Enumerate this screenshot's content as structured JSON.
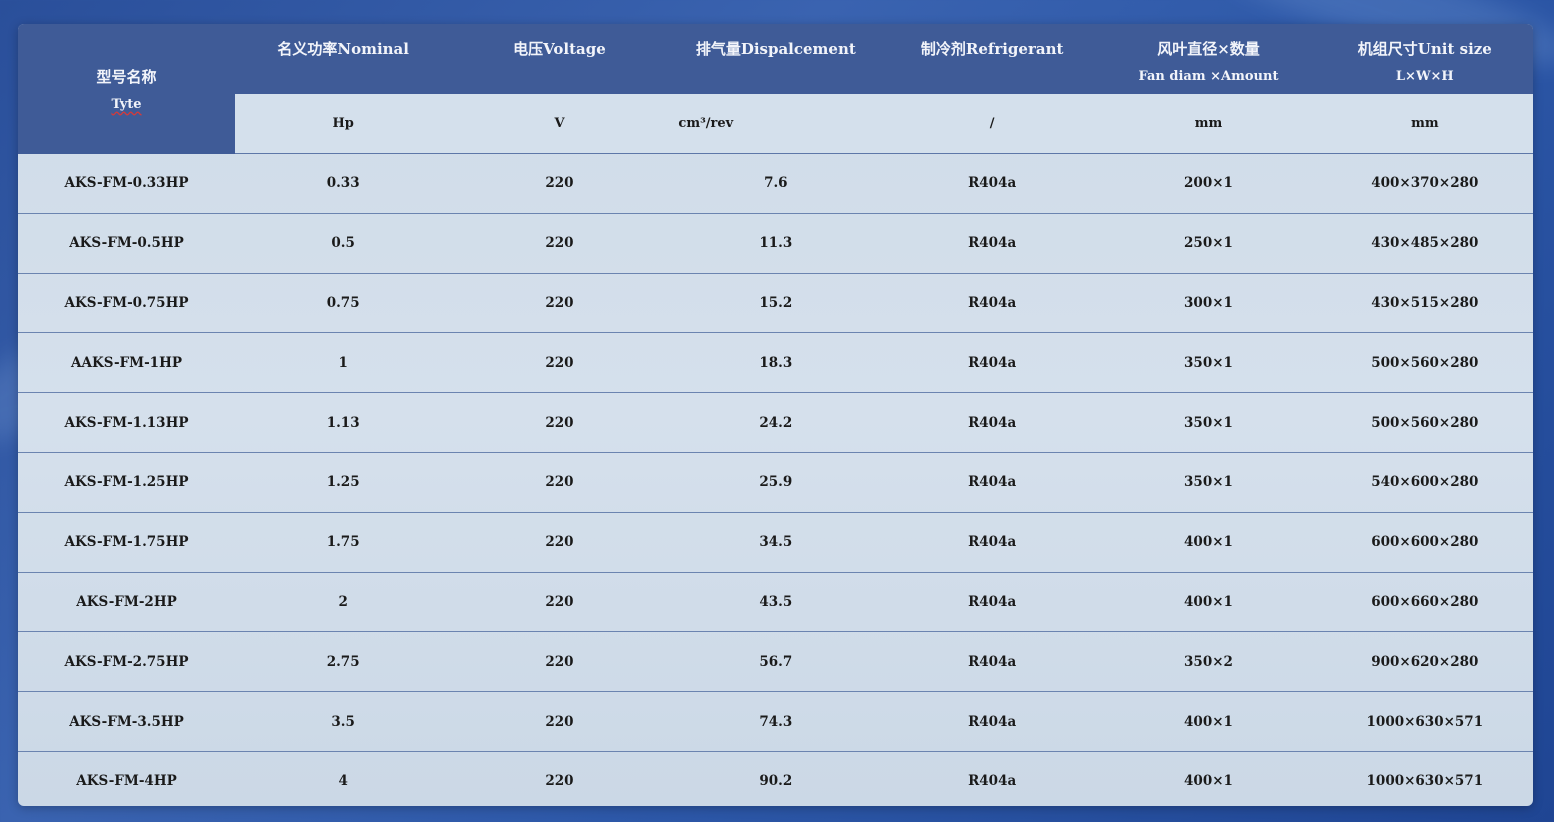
{
  "colors": {
    "header_bg": "#3f5b97",
    "table_bg": "#d4e0ec",
    "row_divider": "#6b84b0",
    "background": "#2d58a8"
  },
  "header": {
    "type": {
      "cn": "型号名称",
      "en": "Tyte"
    },
    "columns": [
      {
        "label": "名义功率Nominal",
        "sub": "",
        "unit": "Hp"
      },
      {
        "label": "电压Voltage",
        "sub": "",
        "unit": "V"
      },
      {
        "label": "排气量Dispalcement",
        "sub": "",
        "unit": "cm³/rev"
      },
      {
        "label": "制冷剂Refrigerant",
        "sub": "",
        "unit": "/"
      },
      {
        "label": "风叶直径×数量",
        "sub": "Fan diam ×Amount",
        "unit": "mm"
      },
      {
        "label": "机组尺寸Unit size",
        "sub": "L×W×H",
        "unit": "mm"
      }
    ]
  },
  "rows": [
    [
      "AKS-FM-0.33HP",
      "0.33",
      "220",
      "7.6",
      "R404a",
      "200×1",
      "400×370×280"
    ],
    [
      "AKS-FM-0.5HP",
      "0.5",
      "220",
      "11.3",
      "R404a",
      "250×1",
      "430×485×280"
    ],
    [
      "AKS-FM-0.75HP",
      "0.75",
      "220",
      "15.2",
      "R404a",
      "300×1",
      "430×515×280"
    ],
    [
      "AAKS-FM-1HP",
      "1",
      "220",
      "18.3",
      "R404a",
      "350×1",
      "500×560×280"
    ],
    [
      "AKS-FM-1.13HP",
      "1.13",
      "220",
      "24.2",
      "R404a",
      "350×1",
      "500×560×280"
    ],
    [
      "AKS-FM-1.25HP",
      "1.25",
      "220",
      "25.9",
      "R404a",
      "350×1",
      "540×600×280"
    ],
    [
      "AKS-FM-1.75HP",
      "1.75",
      "220",
      "34.5",
      "R404a",
      "400×1",
      "600×600×280"
    ],
    [
      "AKS-FM-2HP",
      "2",
      "220",
      "43.5",
      "R404a",
      "400×1",
      "600×660×280"
    ],
    [
      "AKS-FM-2.75HP",
      "2.75",
      "220",
      "56.7",
      "R404a",
      "350×2",
      "900×620×280"
    ],
    [
      "AKS-FM-3.5HP",
      "3.5",
      "220",
      "74.3",
      "R404a",
      "400×1",
      "1000×630×571"
    ],
    [
      "AKS-FM-4HP",
      "4",
      "220",
      "90.2",
      "R404a",
      "400×1",
      "1000×630×571"
    ]
  ]
}
